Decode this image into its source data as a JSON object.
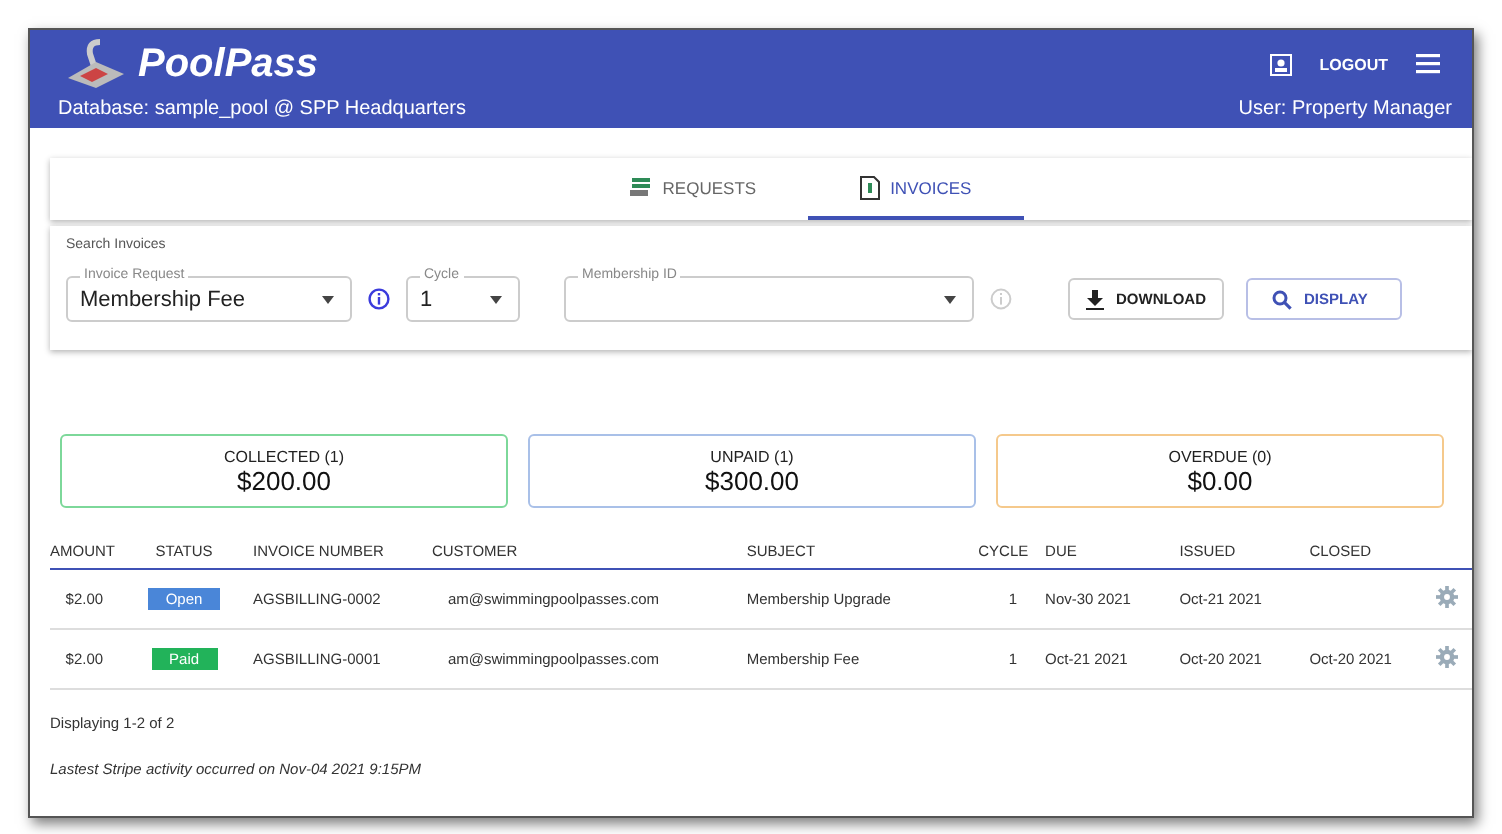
{
  "header": {
    "brand": "PoolPass",
    "logout": "LOGOUT",
    "database": "Database: sample_pool @ SPP Headquarters",
    "user": "User: Property Manager"
  },
  "tabs": [
    {
      "label": "REQUESTS",
      "selected": false
    },
    {
      "label": "INVOICES",
      "selected": true
    }
  ],
  "search": {
    "title": "Search Invoices",
    "invoice_request": {
      "label": "Invoice Request",
      "value": "Membership Fee"
    },
    "cycle": {
      "label": "Cycle",
      "value": "1"
    },
    "membership_id": {
      "label": "Membership ID"
    },
    "download": "DOWNLOAD",
    "display": "DISPLAY"
  },
  "summary": [
    {
      "label": "COLLECTED (1)",
      "amount": "$200.00",
      "color": "#7dd89a"
    },
    {
      "label": "UNPAID (1)",
      "amount": "$300.00",
      "color": "#a9c0e8"
    },
    {
      "label": "OVERDUE (0)",
      "amount": "$0.00",
      "color": "#f5c98c"
    }
  ],
  "table": {
    "columns": [
      "AMOUNT",
      "STATUS",
      "INVOICE NUMBER",
      "CUSTOMER",
      "SUBJECT",
      "CYCLE",
      "DUE",
      "ISSUED",
      "CLOSED"
    ],
    "rows": [
      {
        "amount": "$2.00",
        "status": "Open",
        "color": "#4a86d8",
        "invoice": "AGSBILLING-0002",
        "customer": "am@swimmingpoolpasses.com",
        "subject": "Membership Upgrade",
        "cycle": "1",
        "due": "Nov-30 2021",
        "issued": "Oct-21 2021"
      },
      {
        "amount": "$2.00",
        "status": "Paid",
        "color": "#22b35a",
        "invoice": "AGSBILLING-0001",
        "customer": "am@swimmingpoolpasses.com",
        "subject": "Membership Fee",
        "cycle": "1",
        "due": "Oct-21 2021",
        "issued": "Oct-20 2021",
        "closed": "Oct-20 2021"
      }
    ]
  },
  "footer": {
    "count": "Displaying 1-2 of 2",
    "activity": "Lastest Stripe activity occurred on Nov-04 2021 9:15PM"
  }
}
